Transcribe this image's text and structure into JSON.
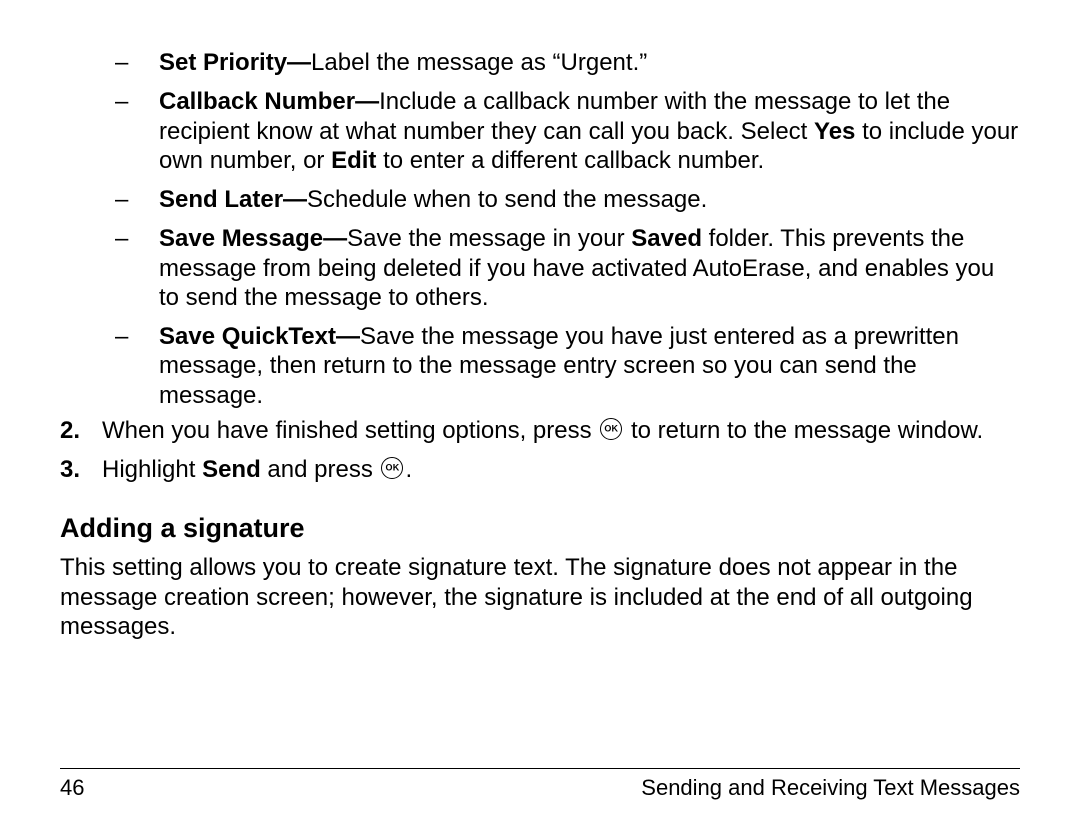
{
  "options": {
    "set_priority": {
      "name": "Set Priority—",
      "desc": "Label the message as “Urgent.”"
    },
    "callback_number": {
      "name": "Callback Number—",
      "desc_a": "Include a callback number with the message to let the recipient know at what number they can call you back. Select ",
      "yes": "Yes",
      "desc_b": " to include your own number, or ",
      "edit": "Edit",
      "desc_c": " to enter a different callback number."
    },
    "send_later": {
      "name": "Send Later—",
      "desc": "Schedule when to send the message."
    },
    "save_message": {
      "name": "Save Message—",
      "desc_a": "Save the message in your ",
      "saved": "Saved",
      "desc_b": " folder. This prevents the message from being deleted if you have activated AutoErase, and enables you to send the message to others."
    },
    "save_quicktext": {
      "name": "Save QuickText—",
      "desc": "Save the message you have just entered as a prewritten message, then return to the message entry screen so you can send the message."
    }
  },
  "steps": {
    "s2_num": "2.",
    "s2_a": "When you have finished setting options, press ",
    "s2_b": " to return to the message window.",
    "s3_num": "3.",
    "s3_a": "Highlight ",
    "s3_send": "Send",
    "s3_b": " and press ",
    "s3_c": "."
  },
  "section": {
    "heading": "Adding a signature",
    "body": "This setting allows you to create signature text. The signature does not appear in the message creation screen; however, the signature is included at the end of all outgoing messages."
  },
  "footer": {
    "page_number": "46",
    "chapter": "Sending and Receiving Text Messages"
  }
}
